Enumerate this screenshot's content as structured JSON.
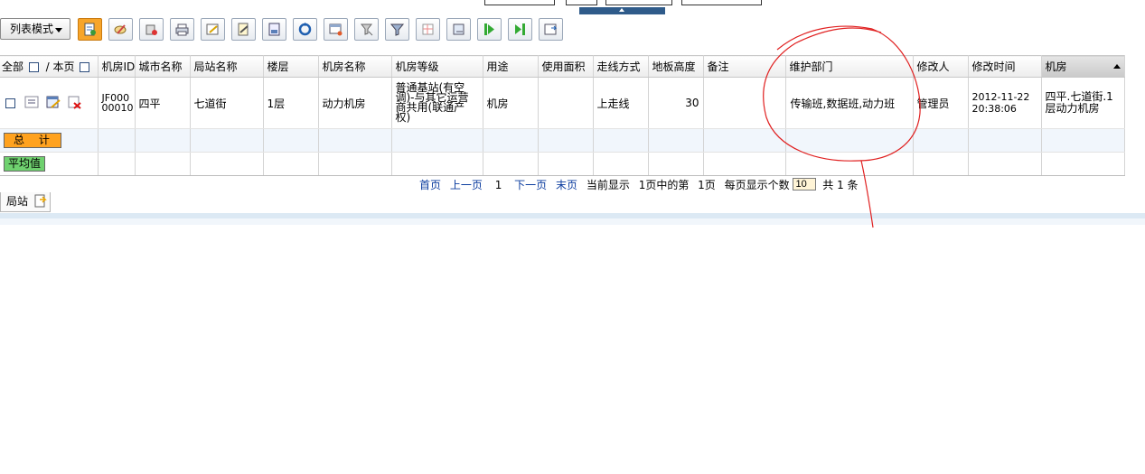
{
  "toolbar": {
    "mode_label": "列表模式",
    "buttons": [
      "new-icon",
      "edit-icon",
      "delete-icon",
      "print-icon",
      "export-icon",
      "import-icon",
      "report-icon",
      "refresh-icon",
      "window-icon",
      "clear-filter-icon",
      "filter-icon",
      "column-icon",
      "save-view-icon",
      "next-icon",
      "last-icon",
      "settings-icon"
    ]
  },
  "grid": {
    "select_all_label": "全部",
    "select_page_label": "/ 本页",
    "headers": [
      "机房ID",
      "城市名称",
      "局站名称",
      "楼层",
      "机房名称",
      "机房等级",
      "用途",
      "使用面积",
      "走线方式",
      "地板高度",
      "备注",
      "维护部门",
      "修改人",
      "修改时间",
      "机房"
    ],
    "row": {
      "id": "JF00000010",
      "city": "四平",
      "station": "七道街",
      "floor": "1层",
      "room_name": "动力机房",
      "level": "普通基站(有空调)-与其它运营商共用(联通产权)",
      "usage": "机房",
      "area": "",
      "routing": "上走线",
      "floor_height": "30",
      "remark": "",
      "maintenance": "传输班,数据班,动力班",
      "modifier": "管理员",
      "modified_time": "2012-11-22 20:38:06",
      "room": "四平.七道街.1层动力机房"
    },
    "sum_label": "总 计",
    "avg_label": "平均值"
  },
  "pager": {
    "first": "首页",
    "prev": "上一页",
    "current": "1",
    "next": "下一页",
    "last": "末页",
    "display": "当前显示",
    "page_info": "1页中的第",
    "page_num": "1页",
    "per_page_label": "每页显示个数",
    "per_page_value": "10",
    "total": "共 1 条"
  },
  "bottom_tab": {
    "label": "局站"
  },
  "colors": {
    "active_button": "#f7a52a",
    "sum_badge": "#ffa21f",
    "avg_badge": "#6fd16f",
    "annotation": "#e02020"
  }
}
